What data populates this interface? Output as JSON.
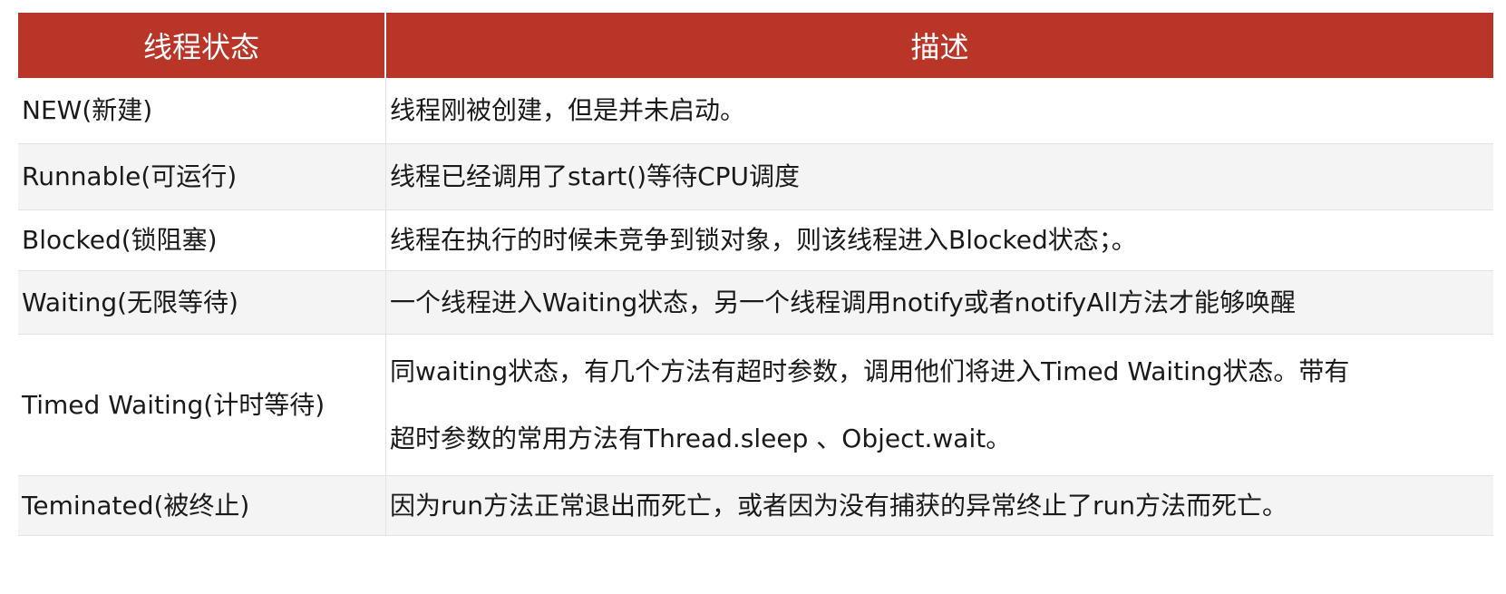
{
  "table": {
    "headers": {
      "state": "线程状态",
      "description": "描述"
    },
    "rows": [
      {
        "state": "NEW(新建)",
        "description": "线程刚被创建，但是并未启动。"
      },
      {
        "state": "Runnable(可运行)",
        "description": "线程已经调用了start()等待CPU调度"
      },
      {
        "state": "Blocked(锁阻塞)",
        "description": "线程在执行的时候未竞争到锁对象，则该线程进入Blocked状态；。"
      },
      {
        "state": "Waiting(无限等待)",
        "description": "一个线程进入Waiting状态，另一个线程调用notify或者notifyAll方法才能够唤醒"
      },
      {
        "state": "Timed Waiting(计时等待)",
        "description_lines": [
          "同waiting状态，有几个方法有超时参数，调用他们将进入Timed Waiting状态。带有",
          "超时参数的常用方法有Thread.sleep 、Object.wait。"
        ]
      },
      {
        "state": "Teminated(被终止)",
        "description": "因为run方法正常退出而死亡，或者因为没有捕获的异常终止了run方法而死亡。"
      }
    ]
  },
  "colors": {
    "header_background": "#b83528",
    "header_text": "#ffffff",
    "alt_row_background": "#f4f4f4"
  }
}
